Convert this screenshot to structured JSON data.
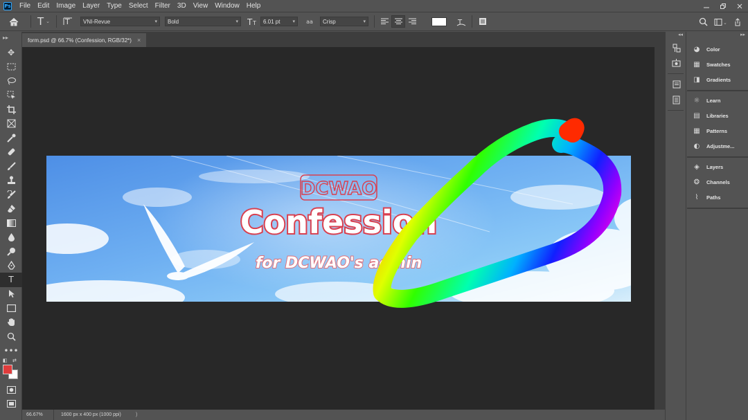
{
  "menubar": {
    "logo": "Ps",
    "items": [
      "File",
      "Edit",
      "Image",
      "Layer",
      "Type",
      "Select",
      "Filter",
      "3D",
      "View",
      "Window",
      "Help"
    ]
  },
  "options": {
    "font_family": "VNI-Revue",
    "font_style": "Bold",
    "font_size": "6.01 pt",
    "antialias_label": "aa",
    "antialias": "Crisp",
    "text_color": "#ffffff"
  },
  "document": {
    "tab_title": "form.psd @ 66.7% (Confession, RGB/32*)",
    "close_glyph": "×"
  },
  "artwork": {
    "logo_text": "DCWAO",
    "title": "Confession",
    "subtitle": "for DCWAO's admin"
  },
  "status": {
    "zoom": "66.67%",
    "doc_info": "1600 px x 400 px (1000 ppi)",
    "arrow": ")"
  },
  "panels": {
    "group1": [
      "Color",
      "Swatches",
      "Gradients"
    ],
    "group2": [
      "Learn",
      "Libraries",
      "Patterns",
      "Adjustme..."
    ],
    "group3": [
      "Layers",
      "Channels",
      "Paths"
    ]
  },
  "colors": {
    "foreground": "#e03c3c",
    "background": "#ffffff",
    "ui_bg": "#535353",
    "canvas_bg": "#282828"
  },
  "icons": {
    "home": "home-icon",
    "type_tool": "type-tool-icon",
    "search": "search-icon",
    "workspace": "workspace-icon",
    "share": "share-icon"
  }
}
